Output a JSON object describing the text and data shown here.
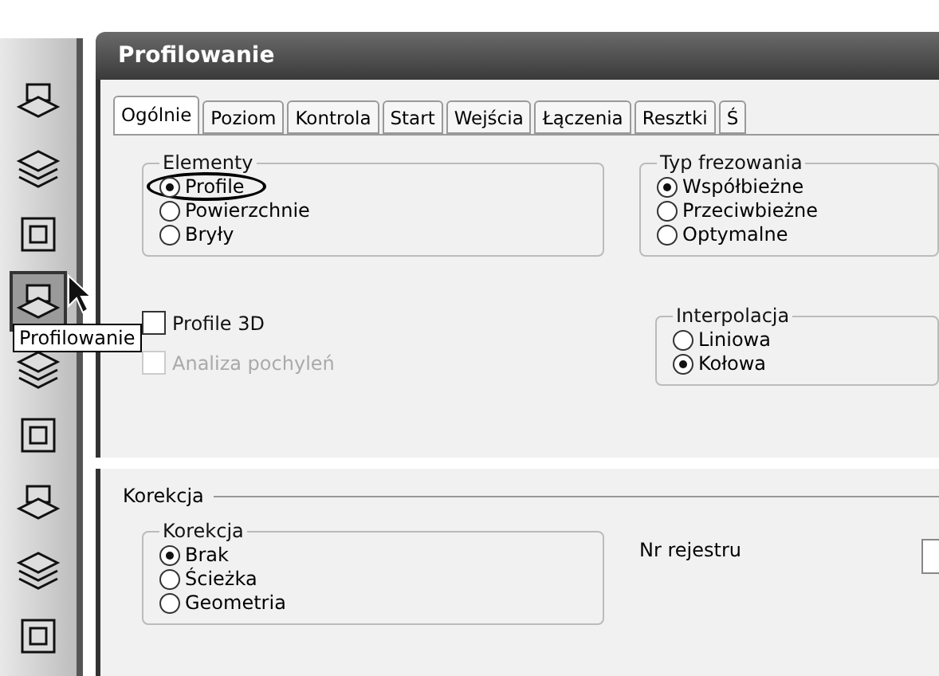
{
  "toolbar": {
    "items": [
      {
        "selected": false
      },
      {
        "selected": false
      },
      {
        "selected": false
      },
      {
        "selected": true
      },
      {
        "selected": false
      },
      {
        "selected": false
      },
      {
        "selected": false
      },
      {
        "selected": false
      },
      {
        "selected": false
      }
    ],
    "tooltip": "Profilowanie"
  },
  "dialog": {
    "title": "Profilowanie",
    "tabs": [
      {
        "label": "Ogólnie",
        "selected": true
      },
      {
        "label": "Poziom",
        "selected": false
      },
      {
        "label": "Kontrola",
        "selected": false
      },
      {
        "label": "Start",
        "selected": false
      },
      {
        "label": "Wejścia",
        "selected": false
      },
      {
        "label": "Łączenia",
        "selected": false
      },
      {
        "label": "Resztki",
        "selected": false
      },
      {
        "label": "Ś",
        "selected": false
      }
    ],
    "elementy": {
      "title": "Elementy",
      "options": [
        {
          "label": "Profile",
          "selected": true,
          "highlighted": true
        },
        {
          "label": "Powierzchnie",
          "selected": false,
          "highlighted": false
        },
        {
          "label": "Bryły",
          "selected": false,
          "highlighted": false
        }
      ]
    },
    "typ_frezowania": {
      "title": "Typ frezowania",
      "options": [
        {
          "label": "Współbieżne",
          "selected": true
        },
        {
          "label": "Przeciwbieżne",
          "selected": false
        },
        {
          "label": "Optymalne",
          "selected": false
        }
      ]
    },
    "checkboxes": [
      {
        "label": "Profile 3D",
        "checked": false,
        "disabled": false
      },
      {
        "label": "Analiza pochyleń",
        "checked": false,
        "disabled": true
      }
    ],
    "interpolacja": {
      "title": "Interpolacja",
      "options": [
        {
          "label": "Liniowa",
          "selected": false
        },
        {
          "label": "Kołowa",
          "selected": true
        }
      ]
    }
  },
  "korekcja_panel": {
    "title": "Korekcja",
    "group": {
      "title": "Korekcja",
      "options": [
        {
          "label": "Brak",
          "selected": true
        },
        {
          "label": "Ścieżka",
          "selected": false
        },
        {
          "label": "Geometria",
          "selected": false
        }
      ]
    },
    "register_label": "Nr rejestru"
  }
}
